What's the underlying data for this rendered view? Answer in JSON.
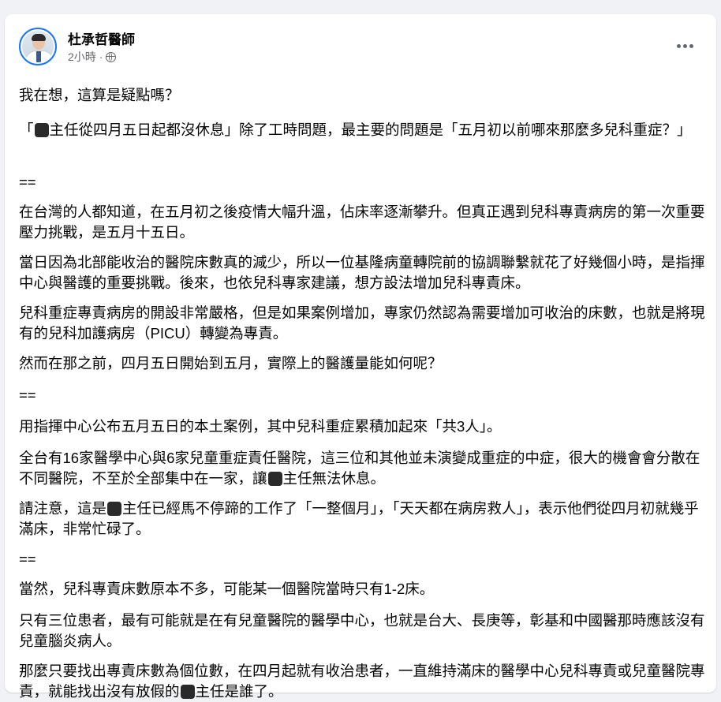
{
  "post": {
    "author": "杜承哲醫師",
    "time": "2小時",
    "dot": "·",
    "icons": {
      "privacy": "globe-icon",
      "menu": "more-options-icon"
    },
    "paragraphs": [
      [
        "我在想，這算是疑點嗎？"
      ],
      [
        "「",
        "[redacted]",
        "主任從四月五日起都沒休息」除了工時問題，最主要的問題是「五月初以前哪來那麼多兒科重症？」"
      ],
      [
        "=="
      ],
      [
        "在台灣的人都知道，在五月初之後疫情大幅升溫，佔床率逐漸攀升。但真正遇到兒科專責病房的第一次重要壓力挑戰，是五月十五日。"
      ],
      [
        "當日因為北部能收治的醫院床數真的減少，所以一位基隆病童轉院前的協調聯繫就花了好幾個小時，是指揮中心與醫護的重要挑戰。後來，也依兒科專家建議，想方設法增加兒科專責床。"
      ],
      [
        "兒科重症專責病房的開設非常嚴格，但是如果案例增加，專家仍然認為需要增加可收治的床數，也就是將現有的兒科加護病房（PICU）轉變為專責。"
      ],
      [
        "然而在那之前，四月五日開始到五月，實際上的醫護量能如何呢？"
      ],
      [
        "=="
      ],
      [
        "用指揮中心公布五月五日的本土案例，其中兒科重症累積加起來「共3人」。"
      ],
      [
        "全台有16家醫學中心與6家兒童重症責任醫院，這三位和其他並未演變成重症的中症，很大的機會會分散在不同醫院，不至於全部集中在一家，讓",
        "[redacted]",
        "主任無法休息。"
      ],
      [
        "請注意，這是",
        "[redacted]",
        "主任已經馬不停蹄的工作了「一整個月」，「天天都在病房救人」，表示他們從四月初就幾乎滿床，非常忙碌了。"
      ],
      [
        "=="
      ],
      [
        "當然，兒科專責床數原本不多，可能某一個醫院當時只有1-2床。"
      ],
      [
        "只有三位患者，最有可能就是在有兒童醫院的醫學中心，也就是台大、長庚等，彰基和中國醫那時應該沒有兒童腦炎病人。"
      ],
      [
        "那麼只要找出專責床數為個位數，在四月起就有收治患者，一直維持滿床的醫學中心兒科專責或兒童醫院專責，就能找出沒有放假的",
        "[redacted]",
        "主任是誰了。"
      ]
    ]
  }
}
